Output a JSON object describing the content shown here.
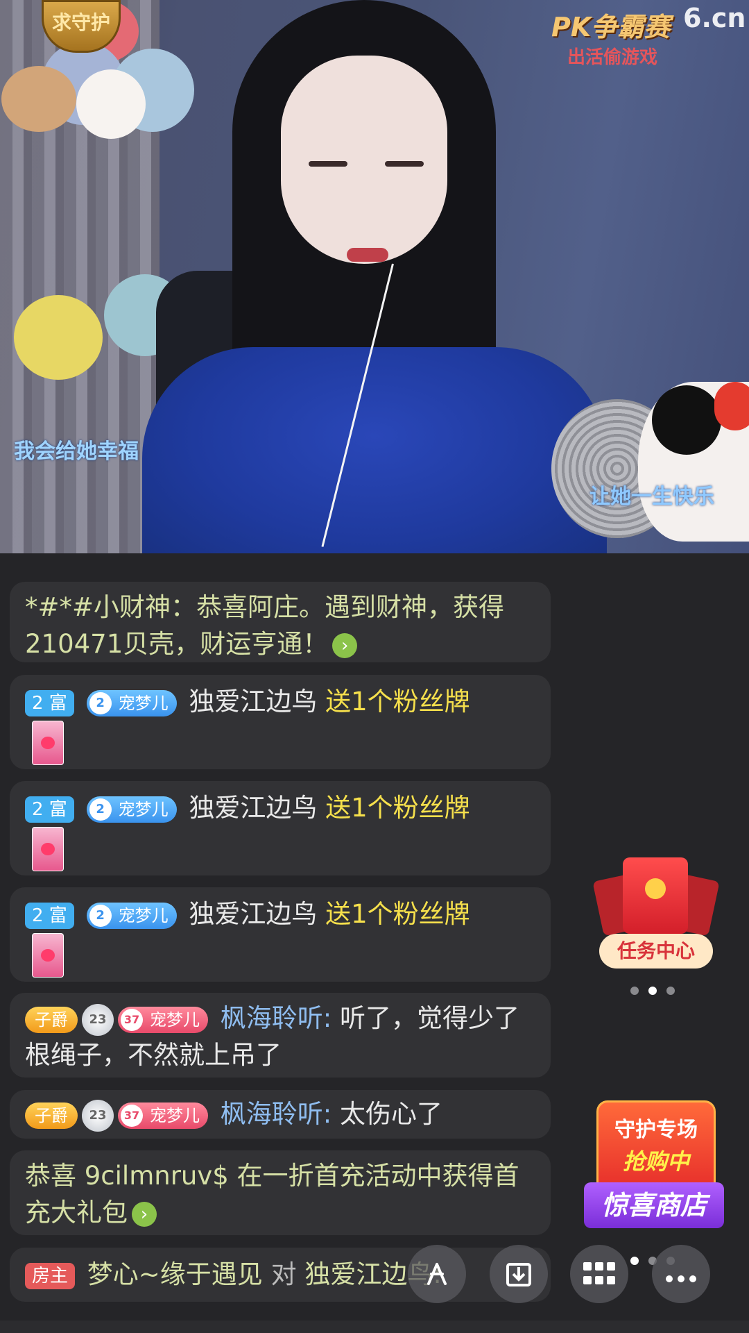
{
  "video": {
    "badge_text": "求守护",
    "pk_title": "PK争霸赛",
    "pk_subtitle": "出活偷游戏",
    "site_logo": "6.cn",
    "caption_left": "我会给她幸福",
    "caption_right": "让她一生快乐"
  },
  "chat": {
    "system1": {
      "text": "*#*#小财神：恭喜阿庄。遇到财神，获得210471贝壳，财运亨通！",
      "icon": "chevron-right-icon"
    },
    "gift_messages": [
      {
        "rich_badge": "2 富",
        "fan_level": "2",
        "fan_name": "宠梦儿",
        "user": "独爱江边鸟",
        "action": "送1个粉丝牌"
      },
      {
        "rich_badge": "2 富",
        "fan_level": "2",
        "fan_name": "宠梦儿",
        "user": "独爱江边鸟",
        "action": "送1个粉丝牌"
      },
      {
        "rich_badge": "2 富",
        "fan_level": "2",
        "fan_name": "宠梦儿",
        "user": "独爱江边鸟",
        "action": "送1个粉丝牌"
      }
    ],
    "comments": [
      {
        "noble": "子爵",
        "guard_level": "23",
        "fan_level": "37",
        "fan_name": "宠梦儿",
        "user": "枫海聆听:",
        "text": "听了，觉得少了根绳子，不然就上吊了"
      },
      {
        "noble": "子爵",
        "guard_level": "23",
        "fan_level": "37",
        "fan_name": "宠梦儿",
        "user": "枫海聆听:",
        "text": "太伤心了"
      }
    ],
    "system2": {
      "text": "恭喜 9cilmnruv$ 在一折首充活动中获得首充大礼包",
      "icon": "chevron-right-icon"
    },
    "last": {
      "badge": "房主",
      "user": "梦心~缘于遇见",
      "connector": "对",
      "target": "独爱江边鸟:"
    }
  },
  "widgets": {
    "task_center": "任务中心",
    "shop_line1": "守护专场",
    "shop_line2": "抢购中",
    "shop_name": "惊喜商店"
  },
  "toolbar": {
    "buttons": [
      "share-icon",
      "download-icon",
      "grid-icon",
      "more-icon"
    ]
  },
  "colors": {
    "chat_bg": "#323235",
    "gift_text": "#f6e04c",
    "system_text": "#d6e0a6",
    "username_blue": "#8fbdf0"
  }
}
